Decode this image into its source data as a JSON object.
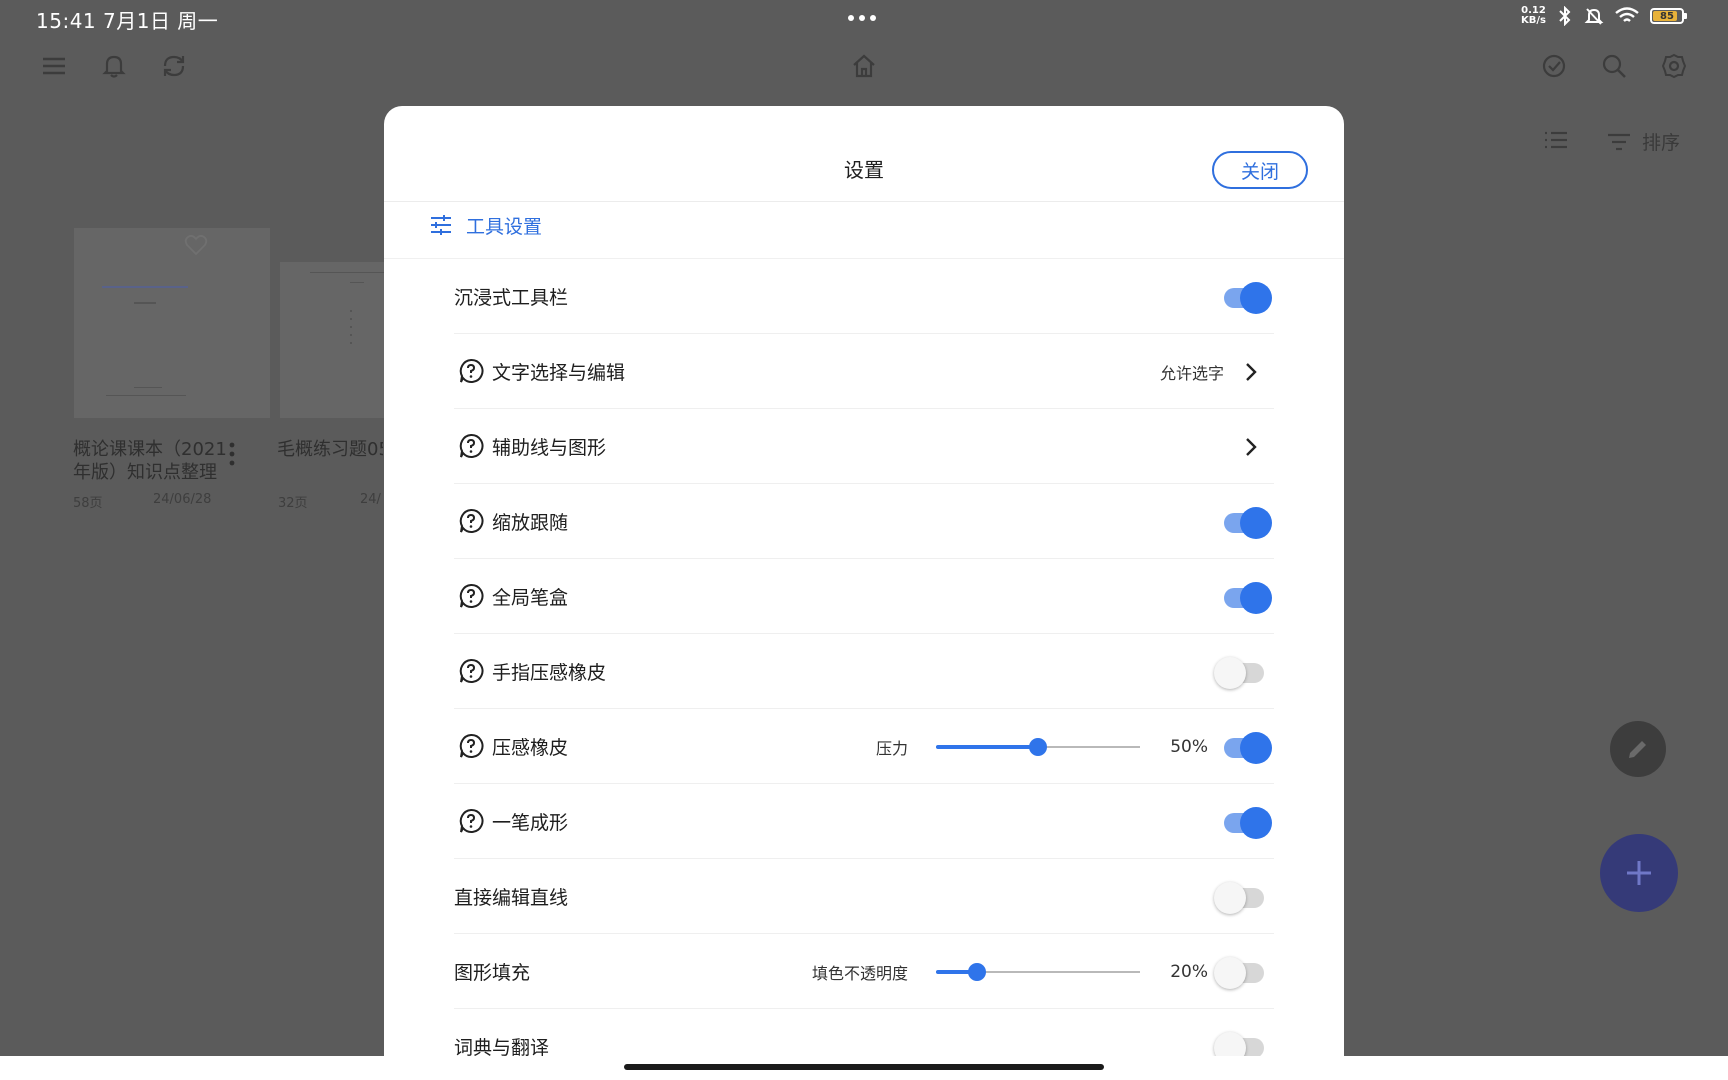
{
  "status_bar": {
    "time_date": "15:41  7月1日 周一",
    "net_speed": "0.12",
    "net_unit": "KB/s",
    "battery": "85"
  },
  "background": {
    "sort_label": "排序",
    "cards": [
      {
        "title": "概论课课本（2021年版）知识点整理",
        "pages": "58页",
        "date": "24/06/28"
      },
      {
        "title": "毛概练习题05",
        "pages": "32页",
        "date": "24/"
      }
    ]
  },
  "dialog": {
    "title": "设置",
    "close_label": "关闭",
    "section_title": "工具设置",
    "rows": [
      {
        "label": "沉浸式工具栏",
        "help_icon": false,
        "toggle": true
      },
      {
        "label": "文字选择与编辑",
        "help_icon": true,
        "value": "允许选字",
        "chevron": true
      },
      {
        "label": "辅助线与图形",
        "help_icon": true,
        "chevron": true
      },
      {
        "label": "缩放跟随",
        "help_icon": true,
        "toggle": true
      },
      {
        "label": "全局笔盒",
        "help_icon": true,
        "toggle": true
      },
      {
        "label": "手指压感橡皮",
        "help_icon": true,
        "toggle": false
      },
      {
        "label": "压感橡皮",
        "help_icon": true,
        "slider_label": "压力",
        "slider_value": "50%",
        "slider_fraction": 0.5,
        "toggle": true
      },
      {
        "label": "一笔成形",
        "help_icon": true,
        "toggle": true
      },
      {
        "label": "直接编辑直线",
        "help_icon": false,
        "toggle": false
      },
      {
        "label": "图形填充",
        "help_icon": false,
        "slider_label": "填色不透明度",
        "slider_value": "20%",
        "slider_fraction": 0.2,
        "toggle": false
      },
      {
        "label": "词典与翻译",
        "help_icon": false,
        "toggle": false
      }
    ]
  },
  "colors": {
    "accent": "#2f74ea",
    "overlay": "#5b5b5b"
  }
}
